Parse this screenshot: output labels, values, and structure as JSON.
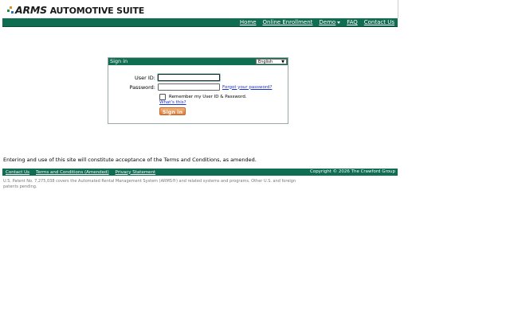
{
  "logo": {
    "brand": "ARMS",
    "suffix": " AUTOMOTIVE SUITE"
  },
  "nav": {
    "items": [
      {
        "label": "Home"
      },
      {
        "label": "Online Enrollment"
      },
      {
        "label": "Demo"
      },
      {
        "label": "FAQ"
      },
      {
        "label": "Contact Us"
      }
    ]
  },
  "signin": {
    "title": "Sign in",
    "language": "English",
    "userid_label": "User ID:",
    "password_label": "Password:",
    "forgot": "Forgot your password?",
    "remember": "Remember my User ID & Password.",
    "whats_this": "What's this?",
    "button": "Sign in"
  },
  "terms": "Entering and use of this site will constitute acceptance of the Terms and Conditions, as amended.",
  "footer": {
    "links": [
      "Contact Us",
      "Terms and Conditions (Amended)",
      "Privacy Statement"
    ],
    "copyright": "Copyright © 2026 The Crawford Group"
  },
  "patent": "U.S. Patent No. 7,275,038 covers the Automated Rental Management System (ARMS®) and related systems and programs. Other U.S. and foreign patents pending.",
  "colors": {
    "brand_green": "#0f6d52",
    "button_orange": "#e07b35",
    "link_blue": "#1a33cc"
  }
}
